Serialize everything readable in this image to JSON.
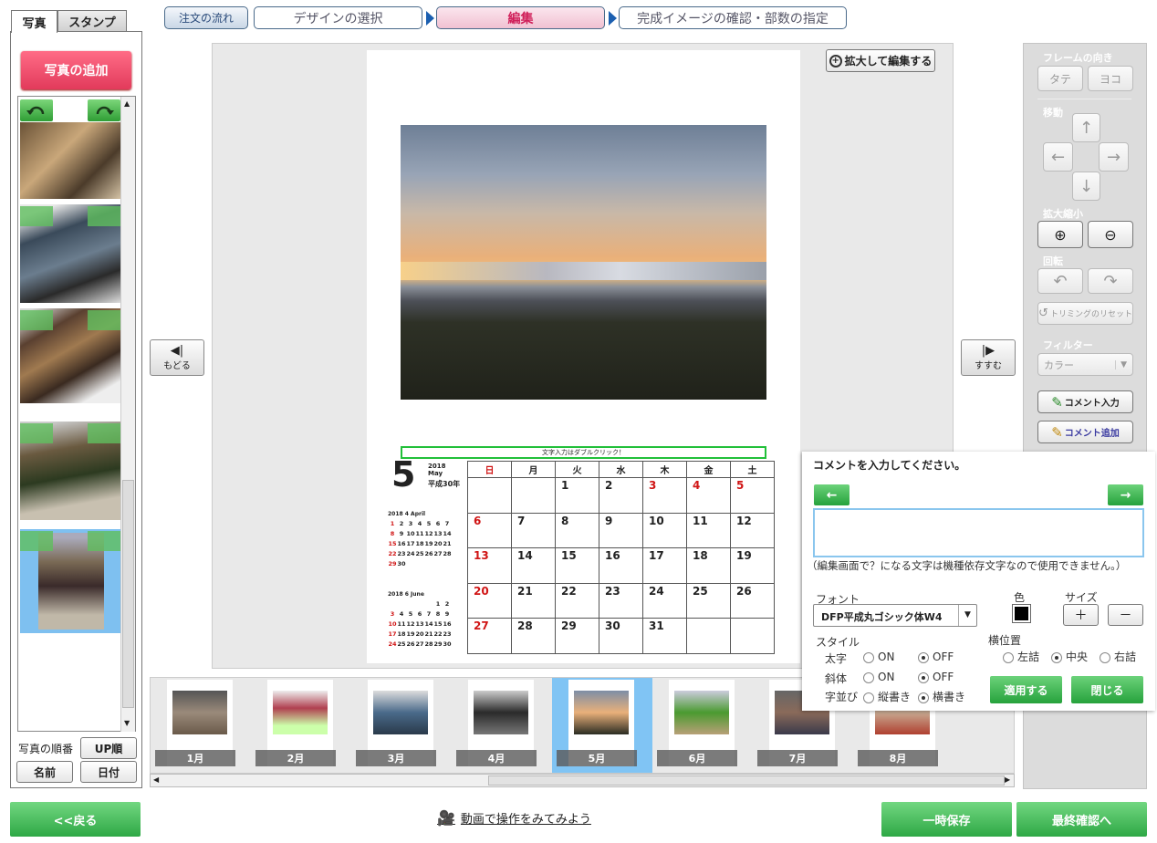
{
  "steps": [
    "注文の流れ",
    "デザインの選択",
    "編集",
    "完成イメージの確認・部数の指定"
  ],
  "left_panel": {
    "tabs": [
      "写真",
      "スタンプ"
    ],
    "add_photo": "写真の追加",
    "sort_label": "写真の順番",
    "sort_up": "UP順",
    "sort_name": "名前",
    "sort_date": "日付"
  },
  "canvas": {
    "zoom_edit": "拡大して編集する",
    "prev": "もどる",
    "next": "すすむ",
    "text_box": "文字入力はダブルクリック！"
  },
  "calendar": {
    "month": "5",
    "year": "2018",
    "month_en": "May",
    "era": "平成30年",
    "weekdays": [
      "日",
      "月",
      "火",
      "水",
      "木",
      "金",
      "土"
    ],
    "weeks": [
      [
        "",
        "",
        "1",
        "2",
        "3",
        "4",
        "5"
      ],
      [
        "6",
        "7",
        "8",
        "9",
        "10",
        "11",
        "12"
      ],
      [
        "13",
        "14",
        "15",
        "16",
        "17",
        "18",
        "19"
      ],
      [
        "20",
        "21",
        "22",
        "23",
        "24",
        "25",
        "26"
      ],
      [
        "27",
        "28",
        "29",
        "30",
        "31",
        "",
        ""
      ]
    ],
    "prev_title": "2018 4 April",
    "prev_weeks": [
      [
        "1",
        "2",
        "3",
        "4",
        "5",
        "6",
        "7"
      ],
      [
        "8",
        "9",
        "10",
        "11",
        "12",
        "13",
        "14"
      ],
      [
        "15",
        "16",
        "17",
        "18",
        "19",
        "20",
        "21"
      ],
      [
        "22",
        "23",
        "24",
        "25",
        "26",
        "27",
        "28"
      ],
      [
        "29",
        "30",
        "",
        "",
        "",
        "",
        ""
      ]
    ],
    "next_title": "2018 6 June",
    "next_weeks": [
      [
        "",
        "",
        "",
        "",
        "",
        "1",
        "2"
      ],
      [
        "3",
        "4",
        "5",
        "6",
        "7",
        "8",
        "9"
      ],
      [
        "10",
        "11",
        "12",
        "13",
        "14",
        "15",
        "16"
      ],
      [
        "17",
        "18",
        "19",
        "20",
        "21",
        "22",
        "23"
      ],
      [
        "24",
        "25",
        "26",
        "27",
        "28",
        "29",
        "30"
      ]
    ]
  },
  "strip": {
    "months": [
      "1月",
      "2月",
      "3月",
      "4月",
      "5月",
      "6月",
      "7月",
      "8月"
    ]
  },
  "right_panel": {
    "frame_label": "フレームの向き",
    "tate": "タテ",
    "yoko": "ヨコ",
    "move_label": "移動",
    "zoom_label": "拡大縮小",
    "rotate_label": "回転",
    "trim_reset": "トリミングのリセット",
    "filter_label": "フィルター",
    "filter_value": "カラー",
    "comment_input": "コメント入力",
    "comment_add": "コメント追加"
  },
  "popup": {
    "title": "コメントを入力してください。",
    "note": "（編集画面で？になる文字は機種依存文字なので使用できません。）",
    "font_label": "フォント",
    "font_value": "DFP平成丸ゴシック体W4",
    "color_label": "色",
    "size_label": "サイズ",
    "plus": "＋",
    "minus": "－",
    "style_label": "スタイル",
    "bold": "太字",
    "italic": "斜体",
    "layout": "字並び",
    "on": "ON",
    "off": "OFF",
    "vertical": "縦書き",
    "horizontal": "横書き",
    "align_label": "横位置",
    "left": "左詰",
    "center": "中央",
    "right": "右詰",
    "apply": "適用する",
    "close": "閉じる",
    "arrow_left": "←",
    "arrow_right": "→",
    "color_value": "#000000"
  },
  "bottom": {
    "back": "<<戻る",
    "video": "動画で操作をみてみよう",
    "save": "一時保存",
    "final": "最終確認へ"
  }
}
